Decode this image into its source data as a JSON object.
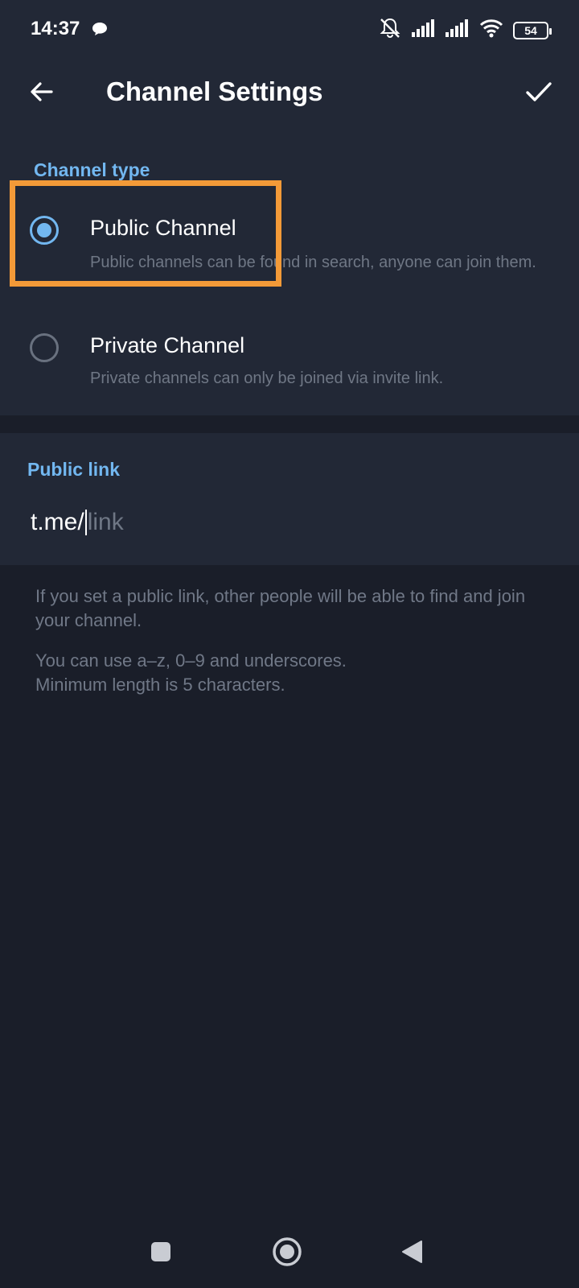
{
  "status_bar": {
    "time": "14:37",
    "battery": "54",
    "icons": [
      "chat-bubble-icon",
      "mute-icon",
      "signal-icon",
      "signal-icon",
      "wifi-icon",
      "battery-icon"
    ]
  },
  "header": {
    "title": "Channel Settings",
    "back_icon": "arrow-left-icon",
    "confirm_icon": "checkmark-icon"
  },
  "channel_type": {
    "label": "Channel type",
    "options": [
      {
        "title": "Public Channel",
        "description": "Public channels can be found in search, anyone can join them.",
        "selected": true
      },
      {
        "title": "Private Channel",
        "description": "Private channels can only be joined via invite link.",
        "selected": false
      }
    ]
  },
  "public_link": {
    "label": "Public link",
    "prefix": "t.me/",
    "value": "",
    "placeholder": "link"
  },
  "help": {
    "line1": "If you set a public link, other people will be able to find and join your channel.",
    "line2a": "You can use a–z, 0–9 and underscores.",
    "line2b": "Minimum length is 5 characters."
  },
  "colors": {
    "accent": "#72b7f0",
    "highlight": "#f39a38",
    "background": "#1a1e29",
    "surface": "#222836"
  }
}
